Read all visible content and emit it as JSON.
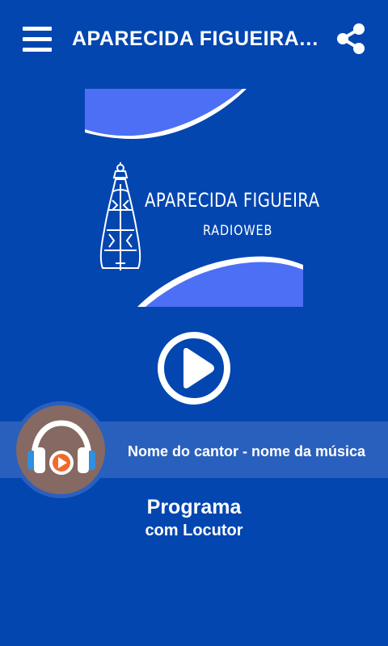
{
  "header": {
    "title": "APARECIDA FIGUEIRA ...",
    "menu_icon": "hamburger-menu-icon",
    "share_icon": "share-icon"
  },
  "logo": {
    "title": "APARECIDA FIGUEIRA",
    "subtitle": "RADIOWEB"
  },
  "player": {
    "play_icon": "play-icon",
    "track": "Nome do cantor - nome da música",
    "program": "Programa",
    "host": "com Locutor",
    "cover_icon": "headphones-icon"
  },
  "colors": {
    "background": "#0346b0",
    "now_playing_bar": "#2a60bd",
    "cover": "#866962",
    "logo_wave": "#4d6ff5"
  }
}
